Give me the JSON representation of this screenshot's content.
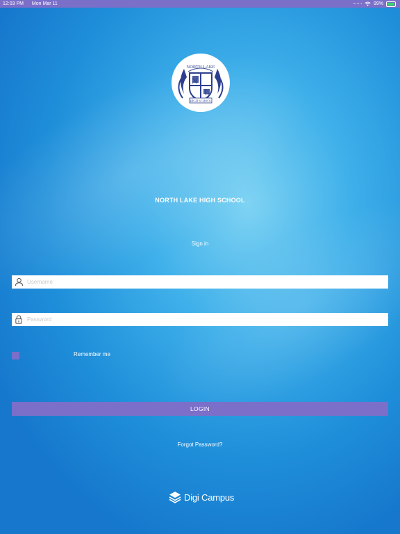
{
  "status_bar": {
    "time": "12:03 PM",
    "date": "Mon Mar 11",
    "battery": "99%"
  },
  "logo": {
    "top_text": "NORTH LAKE",
    "bottom_text": "HIGH SCHOOL",
    "letter_left": "N",
    "letter_right": "L"
  },
  "school_name": "NORTH LAKE HIGH SCHOOL",
  "sign_in_label": "Sign in",
  "username": {
    "value": "",
    "placeholder": "Username"
  },
  "password": {
    "value": "",
    "placeholder": "Password"
  },
  "remember_me": {
    "label": "Remember me",
    "checked": false
  },
  "login_label": "LOGIN",
  "forgot_password": "Forgot Password?",
  "brand": "Digi Campus",
  "colors": {
    "accent": "#7b6fc9",
    "background": "#2a9ae0",
    "logo_blue": "#2c3f8f"
  },
  "icons": {
    "user": "user-icon",
    "lock": "lock-icon",
    "wifi": "wifi-icon",
    "battery": "battery-icon",
    "brand": "layers-icon"
  }
}
